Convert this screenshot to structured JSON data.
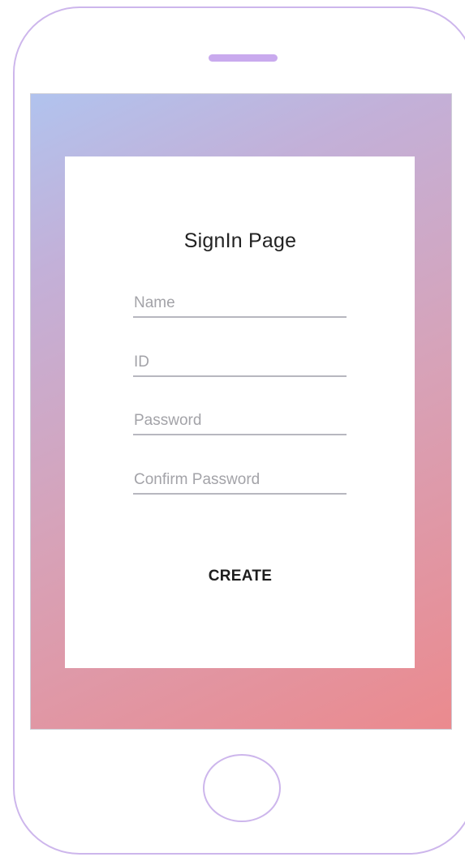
{
  "page": {
    "title": "SignIn Page"
  },
  "form": {
    "name_placeholder": "Name",
    "id_placeholder": "ID",
    "password_placeholder": "Password",
    "confirm_password_placeholder": "Confirm Password",
    "create_label": "CREATE"
  },
  "colors": {
    "device_outline": "#cdb6ec",
    "gradient_top_left": "#b1c3ee",
    "gradient_bottom_right": "#eb8a8e",
    "field_underline": "#b7b7bf"
  }
}
